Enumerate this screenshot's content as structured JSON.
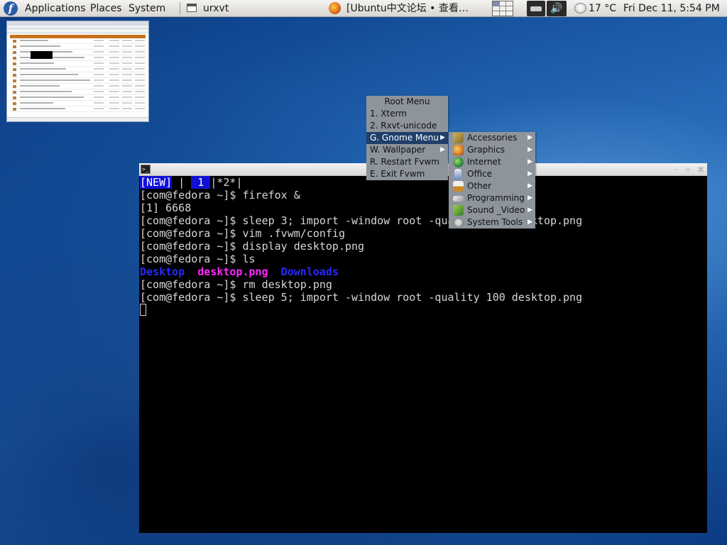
{
  "panel": {
    "menus": [
      "Applications",
      "Places",
      "System"
    ],
    "tasks": [
      {
        "label": "urxvt",
        "icon": "window-icon"
      },
      {
        "label": "[Ubuntu中文论坛 • 查看…",
        "icon": "firefox-icon"
      }
    ],
    "weather": "17 °C",
    "clock": "Fri Dec 11,  5:54 PM"
  },
  "terminal": {
    "tabs": {
      "new": "[NEW]",
      "sep1": " | ",
      "one": " 1 ",
      "two": "|*2*|"
    },
    "lines": [
      "[com@fedora ~]$ firefox &",
      "[1] 6668",
      "[com@fedora ~]$ sleep 3; import -window root -quality 100 desktop.png",
      "[com@fedora ~]$ vim .fvwm/config",
      "[com@fedora ~]$ display desktop.png",
      "[com@fedora ~]$ ls"
    ],
    "ls_output": {
      "dir1": "Desktop",
      "file": "desktop.png",
      "dir2": "Downloads"
    },
    "lines_after": [
      "[com@fedora ~]$ rm desktop.png",
      "[com@fedora ~]$ sleep 5; import -window root -quality 100 desktop.png"
    ]
  },
  "root_menu": {
    "title": "Root Menu",
    "items": [
      "1. Xterm",
      "2. Rxvt-unicode",
      "G. Gnome Menu",
      "W. Wallpaper",
      "R. Restart Fvwm",
      "E. Exit Fvwm"
    ]
  },
  "gnome_menu": {
    "items": [
      "Accessories",
      "Graphics",
      "Internet",
      "Office",
      "Other",
      "Programming",
      "Sound _Video",
      "System Tools"
    ]
  },
  "colors": {
    "menu_bg": "#8e949c",
    "menu_selected": "#1f3f6a",
    "terminal_bg": "#000000",
    "ls_dir": "#2828ff",
    "ls_image": "#ff28ff",
    "tab_highlight": "#1010d8"
  }
}
